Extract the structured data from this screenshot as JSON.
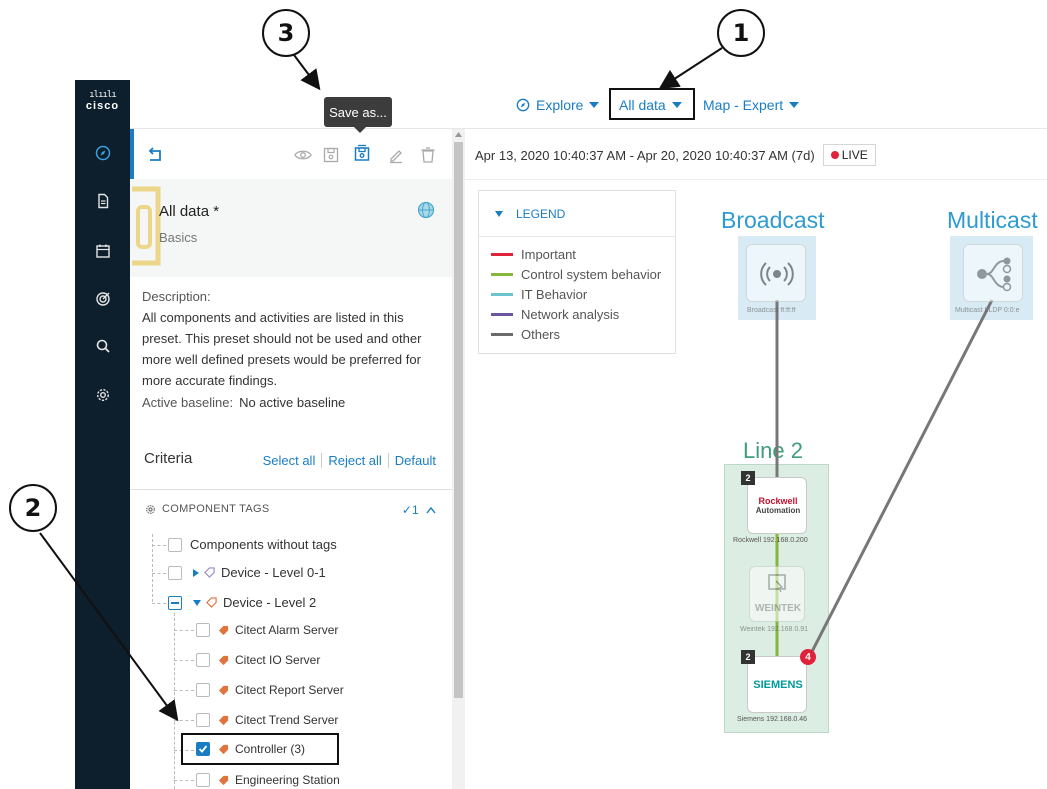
{
  "callouts": [
    "1",
    "2",
    "3"
  ],
  "brand": {
    "bars": "ılıılı",
    "word": "cisco"
  },
  "topbar": {
    "explore_label": "Explore",
    "all_data_label": "All data",
    "map_label": "Map - Expert"
  },
  "tooltip": "Save as...",
  "sidebar": {
    "items": [
      {
        "icon": "compass-icon",
        "active": true
      },
      {
        "icon": "document-icon"
      },
      {
        "icon": "calendar-icon"
      },
      {
        "icon": "target-icon"
      },
      {
        "icon": "search-icon"
      },
      {
        "icon": "gear-icon"
      }
    ]
  },
  "preset": {
    "title": "All data *",
    "subtitle": "Basics",
    "description_label": "Description:",
    "description": "All components and activities are listed in this preset. This preset should not be used and other more well defined presets would be preferred for more accurate findings.",
    "baseline_label": "Active baseline:",
    "baseline_value": "No active baseline"
  },
  "criteria": {
    "title": "Criteria",
    "select_all": "Select all",
    "reject_all": "Reject all",
    "default": "Default"
  },
  "component_tags": {
    "header": "COMPONENT TAGS",
    "count": "✓1",
    "items": [
      {
        "label": "Components without tags",
        "checked": false
      },
      {
        "label": "Device - Level 0-1",
        "checked": false
      },
      {
        "label": "Device - Level 2",
        "checked": "partial"
      },
      {
        "label": "Citect Alarm Server",
        "checked": false
      },
      {
        "label": "Citect IO Server",
        "checked": false
      },
      {
        "label": "Citect Report Server",
        "checked": false
      },
      {
        "label": "Citect Trend Server",
        "checked": false
      },
      {
        "label": "Controller (3)",
        "checked": true
      },
      {
        "label": "Engineering Station",
        "checked": false
      }
    ]
  },
  "timebar": {
    "range": "Apr 13, 2020 10:40:37 AM - Apr 20, 2020 10:40:37 AM (7d)",
    "live": "LIVE"
  },
  "legend": {
    "title": "LEGEND",
    "items": [
      {
        "label": "Important",
        "color": "#e0223a"
      },
      {
        "label": "Control system behavior",
        "color": "#86b63a"
      },
      {
        "label": "IT Behavior",
        "color": "#6cc4cf"
      },
      {
        "label": "Network analysis",
        "color": "#6a559e"
      },
      {
        "label": "Others",
        "color": "#6b6b6b"
      }
    ]
  },
  "map": {
    "zones": [
      {
        "title": "Broadcast"
      },
      {
        "title": "Multicast"
      },
      {
        "title": "Line 2"
      }
    ],
    "nodes": {
      "broadcast": {
        "caption": "Broadcast ff:ff:ff"
      },
      "multicast": {
        "caption": "Multicast LLDP 0:0:e"
      },
      "rockwell": {
        "caption": "Rockwell 192.168.0.200",
        "logo_top": "Rockwell",
        "logo_bottom": "Automation",
        "badge": "2"
      },
      "weintek": {
        "caption": "Weintek 192.168.0.91",
        "logo": "WEINTEK"
      },
      "siemens": {
        "caption": "Siemens 192.168.0.46",
        "logo": "SIEMENS",
        "badge": "2",
        "alerts": "4"
      }
    }
  }
}
